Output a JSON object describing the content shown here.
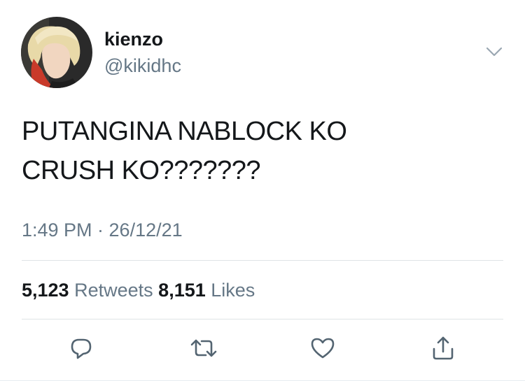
{
  "user": {
    "display_name": "kienzo",
    "handle": "@kikidhc"
  },
  "tweet": {
    "lines": [
      "PUTANGINA NABLOCK KO",
      "CRUSH KO???????"
    ],
    "timestamp": "1:49 PM · 26/12/21"
  },
  "stats": {
    "retweets_count": "5,123",
    "retweets_label": "Retweets",
    "likes_count": "8,151",
    "likes_label": "Likes"
  },
  "icons": {
    "menu": "chevron-down-icon",
    "reply": "reply-icon",
    "retweet": "retweet-icon",
    "like": "heart-icon",
    "share": "share-icon"
  },
  "colors": {
    "text_primary": "#14171a",
    "text_secondary": "#657786",
    "divider": "#dfe3e6"
  }
}
